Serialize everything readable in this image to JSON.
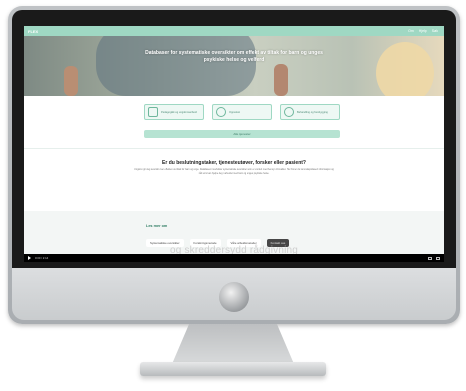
{
  "site": {
    "brand": "FLEX",
    "nav": [
      "Om",
      "Hjelp",
      "Søk"
    ]
  },
  "hero": {
    "title": "Databaser for systematiske oversikter om effekt av tiltak for barn og unges psykiske helse og velferd"
  },
  "services": [
    {
      "label": "Pedagogikk og ungdomsarbeid",
      "icon": "house-icon"
    },
    {
      "label": "Oppvekst",
      "icon": "clock-icon"
    },
    {
      "label": "Behandling og forebygging",
      "icon": "link-icon"
    }
  ],
  "wide_button": {
    "label": "Alle tjenester"
  },
  "question": {
    "title": "Er du beslutningstaker, tjenesteutøver, forsker eller pasient?",
    "text": "Ungsinn gir deg oversikt over effekten av tiltak for barn og unge. Databasen inneholder systematiske oversikter som er vurdert med hensyn til kvalitet. Her finner du kunnskapsbasert informasjon og råd som kan hjelpe deg i arbeidet med barn og unges psykiske helse."
  },
  "read_more": {
    "title": "Les mer om",
    "links": [
      "Systematiske oversikter",
      "Forskningsmetode",
      "Våre arbeidsmetoder",
      "Kontakt oss"
    ]
  },
  "video": {
    "subtitle": "og skreddersydd rådgivning",
    "timecode": "0:00 / 2:14"
  },
  "colors": {
    "accent": "#9fd8c3",
    "accent_dark": "#2f7d63"
  }
}
